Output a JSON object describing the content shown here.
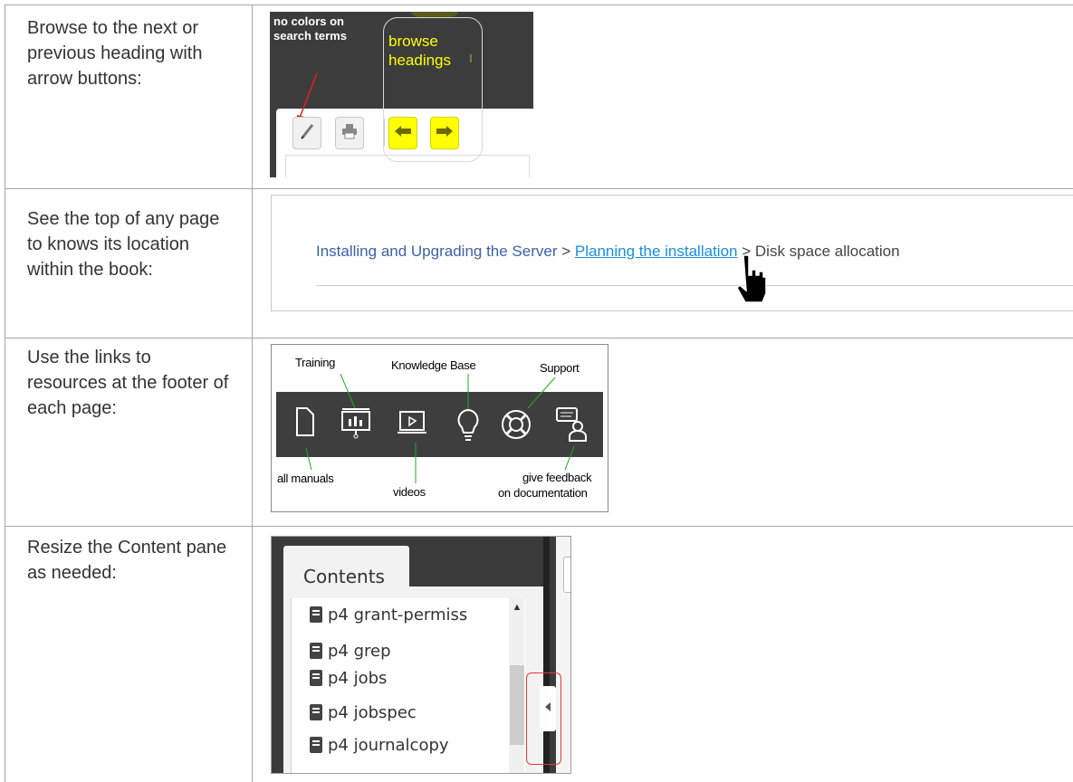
{
  "rows": [
    {
      "description": "Browse to the next or previous heading with arrow buttons:"
    },
    {
      "description": "See the top of any page to knows its location within the book:"
    },
    {
      "description": "Use the links to resources at the footer of each page:"
    },
    {
      "description": "Resize the Content pane as needed:"
    }
  ],
  "toolbar_demo": {
    "note_search": "no colors on search terms",
    "note_browse": "browse headings",
    "buttons": [
      {
        "icon": "highlighter-icon"
      },
      {
        "icon": "print-icon"
      },
      {
        "icon": "arrow-left-icon"
      },
      {
        "icon": "arrow-right-icon"
      }
    ]
  },
  "breadcrumb_demo": {
    "level1": "Installing and Upgrading the Server",
    "separator": ">",
    "level2": "Planning the installation",
    "level3": "Disk space allocation",
    "cursor_icon": "hand-pointer-icon"
  },
  "footer_demo": {
    "top_labels": {
      "training": "Training",
      "knowledge_base": "Knowledge Base",
      "support": "Support"
    },
    "bottom_labels": {
      "all_manuals": "all manuals",
      "videos": "videos",
      "feedback_line1": "give feedback",
      "feedback_line2": "on documentation"
    },
    "icons": [
      "document-icon",
      "presentation-icon",
      "video-icon",
      "lightbulb-icon",
      "lifebuoy-icon",
      "feedback-icon"
    ]
  },
  "contents_demo": {
    "tab_label": "Contents",
    "items": [
      "p4 grant-permiss",
      "p4 grep",
      "p4 jobs",
      "p4 jobspec",
      "p4 journalcopy"
    ]
  }
}
